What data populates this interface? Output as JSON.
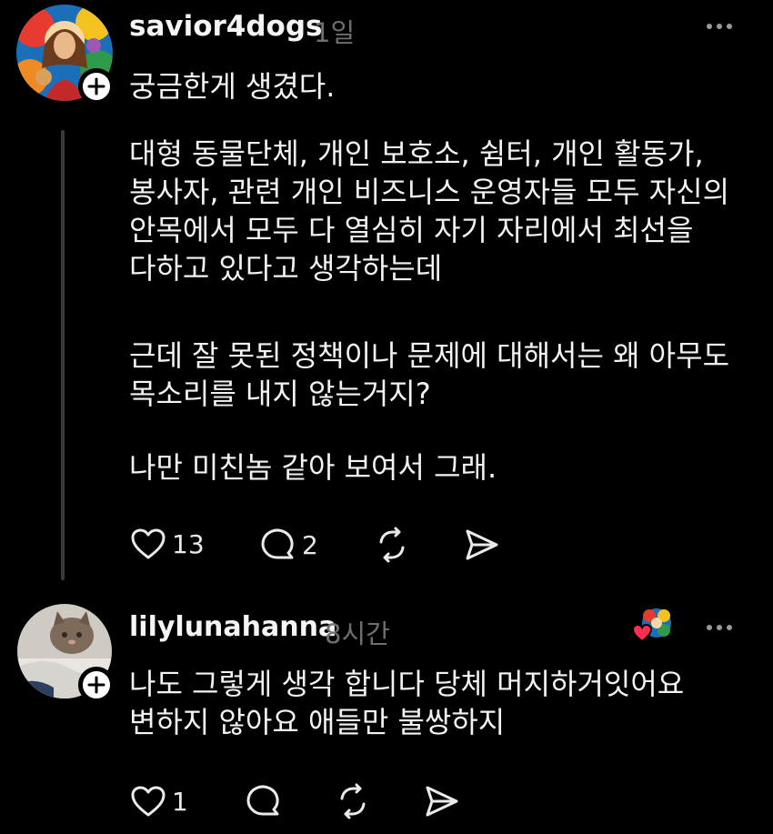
{
  "posts": [
    {
      "username": "savior4dogs",
      "time": "1일",
      "paragraphs": [
        "궁금한게 생겼다.",
        "대형 동물단체, 개인 보호소, 쉼터, 개인 활동가,\n봉사자, 관련 개인 비즈니스 운영자들 모두 자신의\n안목에서 모두 다 열심히 자기 자리에서 최선을\n다하고 있다고 생각하는데",
        "근데 잘 못된 정책이나 문제에 대해서는 왜 아무도\n목소리를 내지 않는거지?",
        "나만 미친놈 같아 보여서 그래."
      ],
      "likes": "13",
      "replies": "2"
    },
    {
      "username": "lilylunahanna",
      "time": "8시간",
      "paragraphs": [
        "나도 그렇게 생각 합니다 당체 머지하거잇어요\n변하지 않아요 애들만 불쌍하지"
      ],
      "likes": "1",
      "replies": ""
    }
  ],
  "icons": {
    "like": "heart-icon",
    "reply": "comment-bubble-icon",
    "repost": "repost-icon",
    "share": "send-icon",
    "more": "more-dots-icon",
    "follow": "plus-icon"
  },
  "colors": {
    "background": "#000000",
    "text": "#f3f3f3",
    "muted": "#6f6f6f",
    "liked_heart": "#ff2d4f"
  }
}
